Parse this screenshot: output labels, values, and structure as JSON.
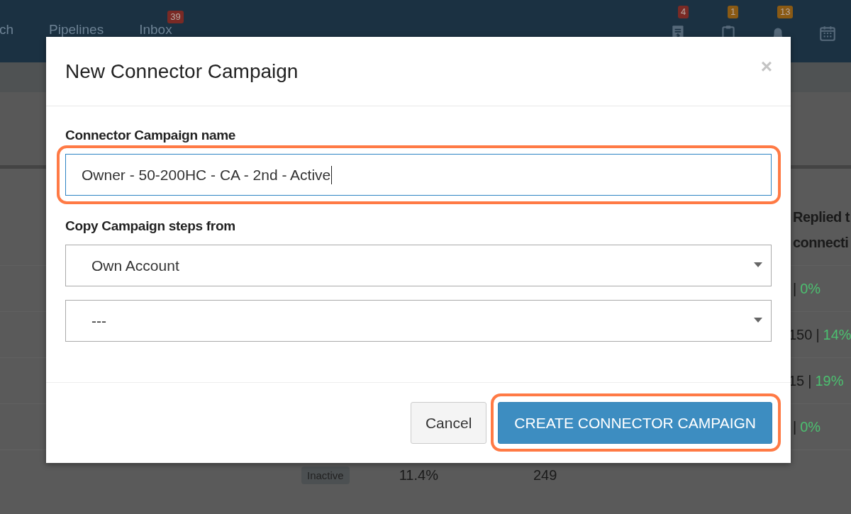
{
  "navbar": {
    "links": [
      {
        "label": "ch"
      },
      {
        "label": "Pipelines"
      },
      {
        "label": "Inbox",
        "badge": "39"
      }
    ],
    "icons": [
      {
        "kind": "invoice",
        "badge": "4",
        "color": "#7a2a25"
      },
      {
        "kind": "clipboard",
        "badge": "1",
        "color": "#8a5a14"
      },
      {
        "kind": "bell",
        "badge": "13",
        "color": "#8a5a14"
      },
      {
        "kind": "calendar"
      }
    ]
  },
  "table": {
    "header_lines": [
      "Replied t",
      "connecti"
    ],
    "rows": [
      {
        "separator": "|",
        "rate": "0%"
      },
      {
        "count": "150",
        "separator": "|",
        "rate": "14%"
      },
      {
        "count": "15",
        "separator": "|",
        "rate": "19%"
      },
      {
        "separator": "|",
        "rate": "0%"
      }
    ],
    "last_row": {
      "status": "Inactive",
      "percent": "11.4%",
      "count": "249"
    }
  },
  "modal": {
    "title": "New Connector Campaign",
    "close": "×",
    "fields": [
      {
        "kind": "text",
        "label": "Connector Campaign name",
        "value": "Owner - 50-200HC - CA - 2nd - Active",
        "focused": true,
        "highlighted": true
      },
      {
        "kind": "select",
        "label": "Copy Campaign steps from",
        "value": "Own Account",
        "focused": false,
        "highlighted": false
      },
      {
        "kind": "select",
        "value": "---",
        "focused": false,
        "highlighted": false
      }
    ],
    "buttons": [
      {
        "kind": "default",
        "label": "Cancel",
        "highlighted": false
      },
      {
        "kind": "primary",
        "label": "CREATE CONNECTOR CAMPAIGN",
        "highlighted": true
      }
    ]
  }
}
